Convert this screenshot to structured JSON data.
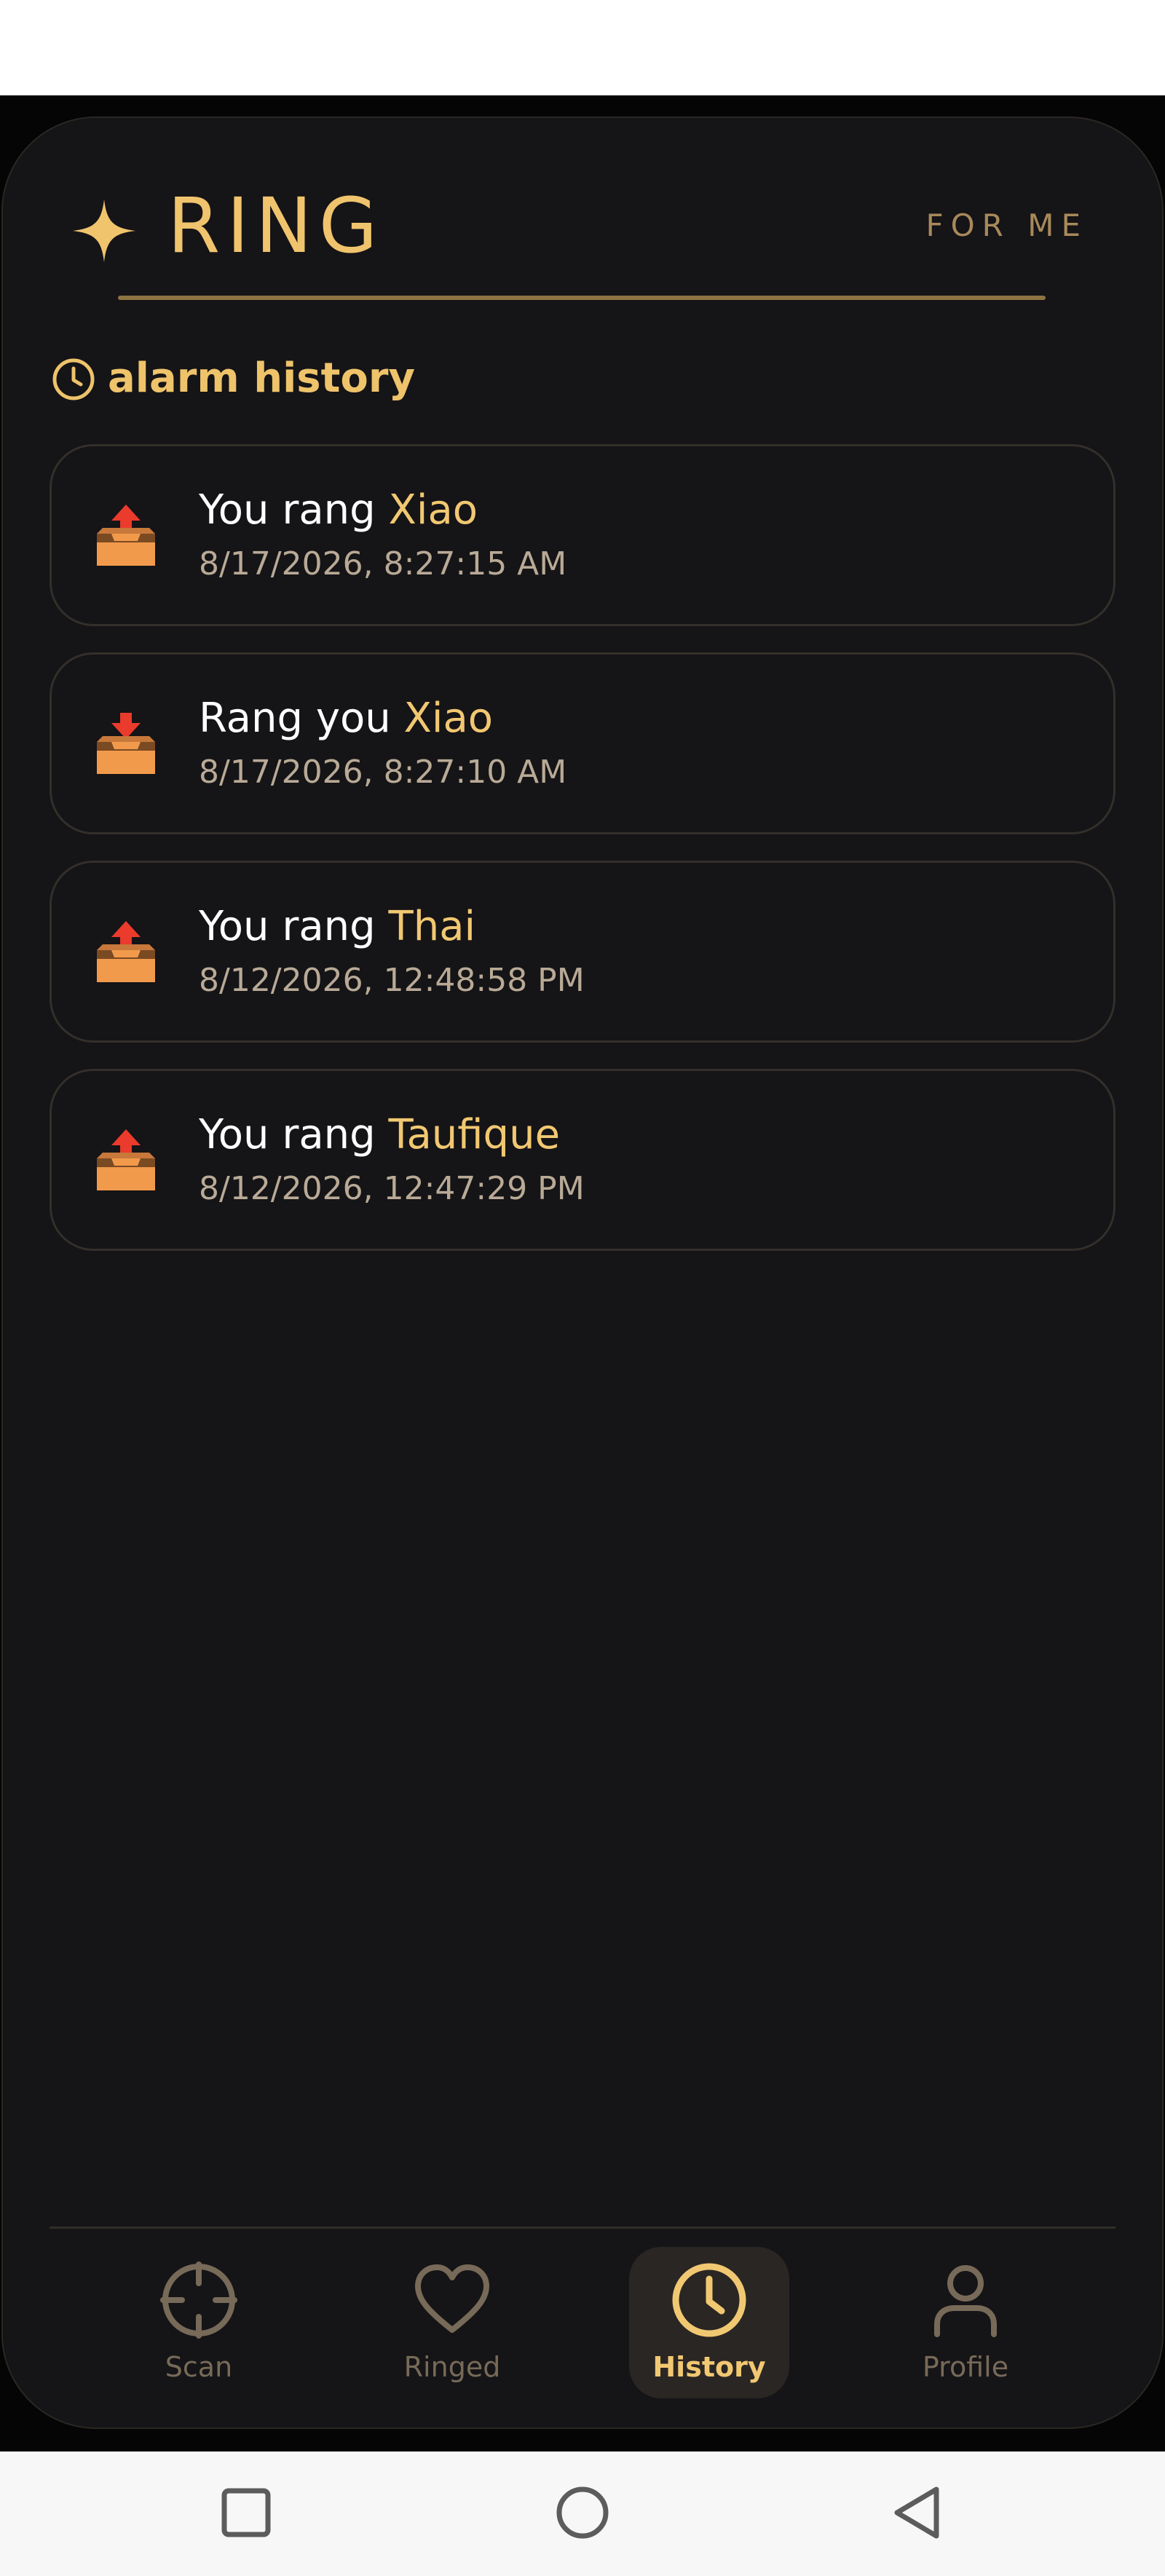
{
  "header": {
    "title": "RING",
    "right_label": "FOR ME",
    "accent_color": "#f0c46d"
  },
  "section": {
    "title": "alarm history",
    "icon": "clock-icon"
  },
  "history": [
    {
      "prefix": "You rang ",
      "name": "Xiao",
      "time": "8/17/2026, 8:27:15 AM",
      "direction": "outgoing",
      "icon": "outbox-tray-icon"
    },
    {
      "prefix": "Rang you ",
      "name": "Xiao",
      "time": "8/17/2026, 8:27:10 AM",
      "direction": "incoming",
      "icon": "inbox-tray-icon"
    },
    {
      "prefix": "You rang ",
      "name": "Thai",
      "time": "8/12/2026, 12:48:58 PM",
      "direction": "outgoing",
      "icon": "outbox-tray-icon"
    },
    {
      "prefix": "You rang ",
      "name": "Taufique",
      "time": "8/12/2026, 12:47:29 PM",
      "direction": "outgoing",
      "icon": "outbox-tray-icon"
    }
  ],
  "nav": {
    "items": [
      {
        "label": "Scan",
        "icon": "crosshair-icon",
        "active": false
      },
      {
        "label": "Ringed",
        "icon": "heart-icon",
        "active": false
      },
      {
        "label": "History",
        "icon": "clock-icon",
        "active": true
      },
      {
        "label": "Profile",
        "icon": "person-icon",
        "active": false
      }
    ]
  },
  "system_nav": [
    "recents-button",
    "home-button",
    "back-button"
  ]
}
